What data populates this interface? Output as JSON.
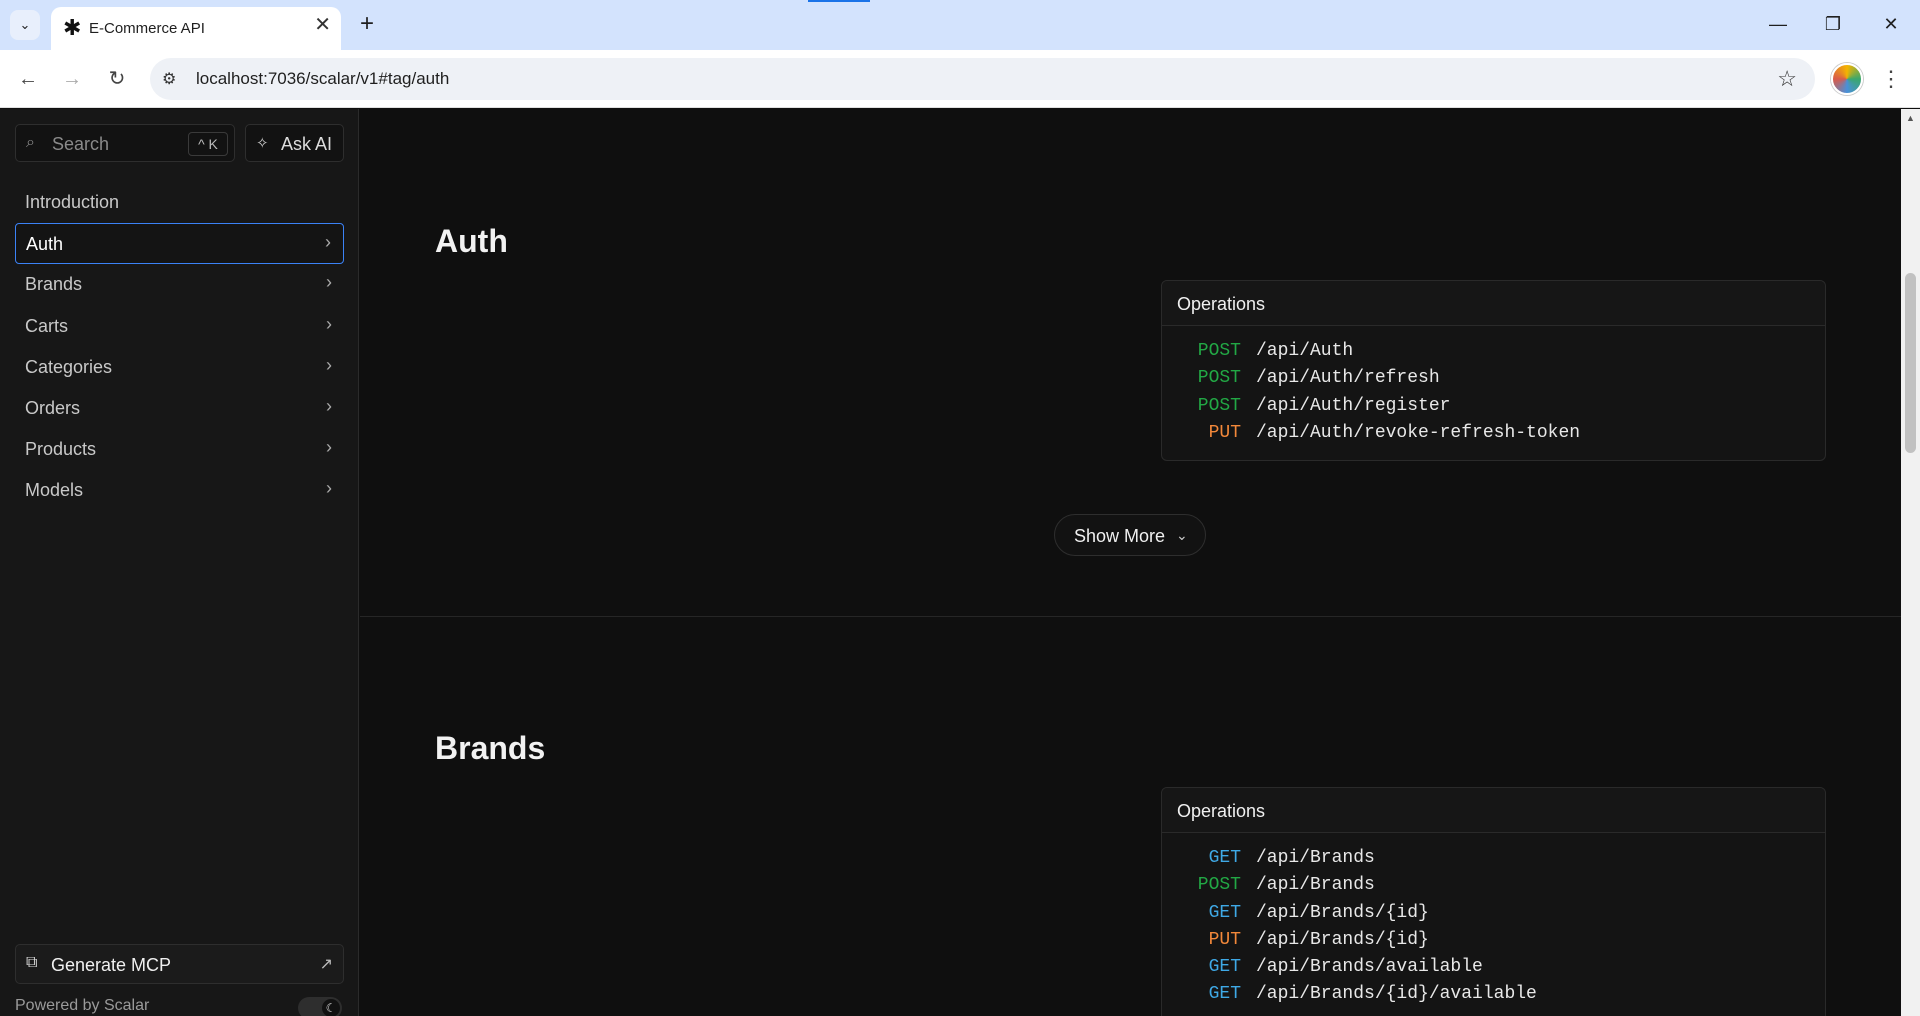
{
  "browser": {
    "tab_title": "E-Commerce API",
    "tab_favicon": "asterisk-logo",
    "url": "localhost:7036/scalar/v1#tag/auth",
    "icons": {
      "tab_list": "chevron-down-icon",
      "close": "close-icon",
      "new_tab": "plus-icon",
      "back": "back-arrow-icon",
      "forward": "forward-arrow-icon",
      "reload": "reload-icon",
      "site_info": "site-settings-icon",
      "bookmark": "star-icon",
      "menu": "more-vert-icon"
    },
    "glyphs": {
      "tab_list": "⌄",
      "favicon": "✱",
      "close": "✕",
      "new_tab": "+",
      "minimize": "—",
      "restore": "❐",
      "win_close": "✕",
      "back": "←",
      "forward": "→",
      "reload": "↻",
      "site_info": "⚙",
      "star": "☆",
      "menu": "⋮"
    }
  },
  "sidebar": {
    "search_placeholder": "Search",
    "search_shortcut": "^ K",
    "ask_ai_label": "Ask AI",
    "items": [
      {
        "label": "Introduction",
        "has_chevron": false,
        "active": false
      },
      {
        "label": "Auth",
        "has_chevron": true,
        "active": true
      },
      {
        "label": "Brands",
        "has_chevron": true,
        "active": false
      },
      {
        "label": "Carts",
        "has_chevron": true,
        "active": false
      },
      {
        "label": "Categories",
        "has_chevron": true,
        "active": false
      },
      {
        "label": "Orders",
        "has_chevron": true,
        "active": false
      },
      {
        "label": "Products",
        "has_chevron": true,
        "active": false
      },
      {
        "label": "Models",
        "has_chevron": true,
        "active": false
      }
    ],
    "generate_mcp_label": "Generate MCP",
    "powered_by": "Powered by Scalar",
    "theme_toggle_icon": "moon-icon"
  },
  "main": {
    "sections": [
      {
        "title": "Auth",
        "operations_title": "Operations",
        "operations": [
          {
            "method": "POST",
            "path": "/api/Auth"
          },
          {
            "method": "POST",
            "path": "/api/Auth/refresh"
          },
          {
            "method": "POST",
            "path": "/api/Auth/register"
          },
          {
            "method": "PUT",
            "path": "/api/Auth/revoke-refresh-token"
          }
        ],
        "show_more_label": "Show More"
      },
      {
        "title": "Brands",
        "operations_title": "Operations",
        "operations": [
          {
            "method": "GET",
            "path": "/api/Brands"
          },
          {
            "method": "POST",
            "path": "/api/Brands"
          },
          {
            "method": "GET",
            "path": "/api/Brands/{id}"
          },
          {
            "method": "PUT",
            "path": "/api/Brands/{id}"
          },
          {
            "method": "GET",
            "path": "/api/Brands/available"
          },
          {
            "method": "GET",
            "path": "/api/Brands/{id}/available"
          }
        ]
      }
    ]
  },
  "colors": {
    "post": "#22a845",
    "put": "#f2883a",
    "get": "#3fa9e6",
    "active_border": "#3b82f6",
    "tab_strip": "#d3e3fd"
  }
}
